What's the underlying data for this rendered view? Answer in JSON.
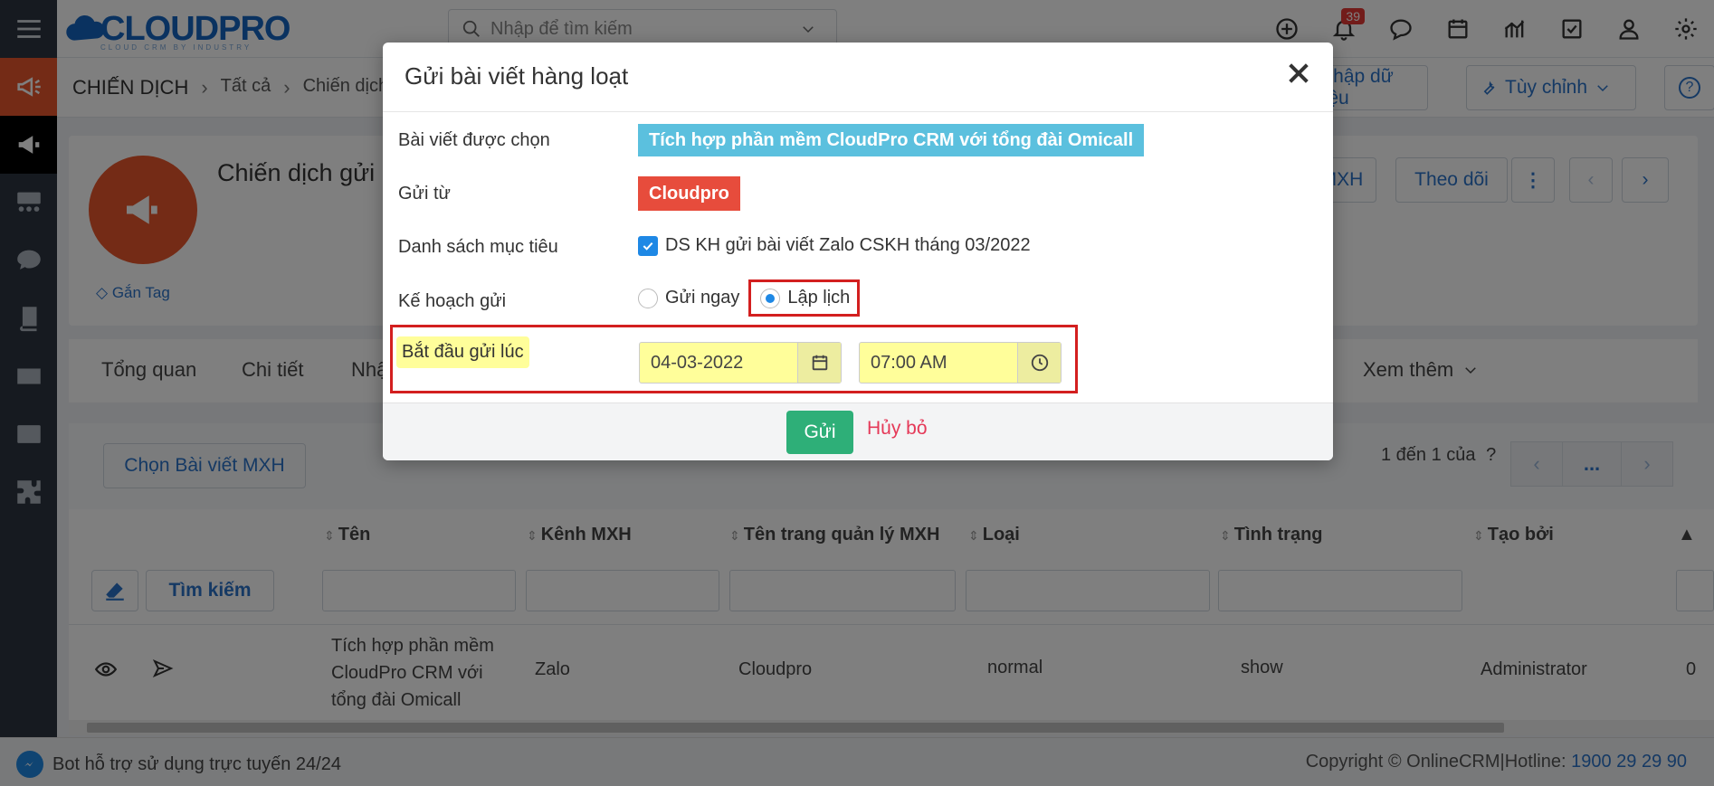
{
  "app": {
    "logo": "CLOUDPRO",
    "logo_sub": "CLOUD CRM BY INDUSTRY",
    "search_placeholder": "Nhập để tìm kiếm",
    "notification_count": "39"
  },
  "breadcrumb": {
    "module": "CHIẾN DỊCH",
    "level1": "Tất cả",
    "level2": "Chiến dịch g"
  },
  "header_buttons": {
    "import": "Nhập dữ liệu",
    "customize": "Tùy chỉnh",
    "help": "?"
  },
  "record": {
    "title": "Chiến dịch gửi",
    "tag_label": "Gắn Tag",
    "btn_mxh": "MXH",
    "btn_follow": "Theo dõi"
  },
  "tabs": {
    "overview": "Tổng quan",
    "detail": "Chi tiết",
    "third": "Nhậ",
    "more": "Xem thêm"
  },
  "list": {
    "pick_button": "Chọn Bài viết MXH",
    "pager_text": "1 đến 1 của",
    "pager_help": "?",
    "pager_more": "...",
    "columns": [
      "Tên",
      "Kênh MXH",
      "Tên trang quản lý MXH",
      "Loại",
      "Tình trạng",
      "Tạo bởi"
    ],
    "search_button": "Tìm kiếm",
    "row": {
      "name": [
        "Tích hợp phần mềm",
        "CloudPro CRM với",
        "tổng đài Omicall"
      ],
      "channel": "Zalo",
      "page": "Cloudpro",
      "type": "normal",
      "status": "show",
      "created_by": "Administrator",
      "extra": "0"
    }
  },
  "footer": {
    "bot_text": "Bot hỗ trợ sử dụng trực tuyến 24/24",
    "copyright": "Copyright © OnlineCRM|Hotline:",
    "hotline": "1900 29 29 90"
  },
  "modal": {
    "title": "Gửi bài viết hàng loạt",
    "label_post": "Bài viết được chọn",
    "post_value": "Tích hợp phần mềm CloudPro CRM với tổng đài Omicall",
    "label_from": "Gửi từ",
    "from_value": "Cloudpro",
    "label_target": "Danh sách mục tiêu",
    "target_value": "DS KH gửi bài viết Zalo CSKH tháng 03/2022",
    "label_plan": "Kế hoạch gửi",
    "plan_now": "Gửi ngay",
    "plan_schedule": "Lập lịch",
    "label_start": "Bắt đầu gửi lúc",
    "date_value": "04-03-2022",
    "time_value": "07:00 AM",
    "send_button": "Gửi",
    "cancel_button": "Hủy bỏ"
  }
}
